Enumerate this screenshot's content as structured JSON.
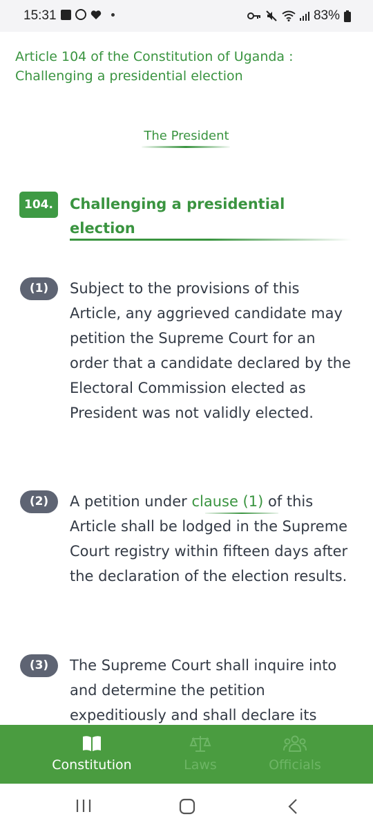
{
  "status_bar": {
    "time": "15:31",
    "battery": "83%",
    "left_icons": [
      "gallery-icon",
      "whatsapp-icon",
      "heart-icon",
      "dot-icon"
    ],
    "right_icons": [
      "key-icon",
      "mute-icon",
      "wifi-icon",
      "signal-icon",
      "battery-icon"
    ]
  },
  "article": {
    "header": "Article 104 of the Constitution of Uganda : Challenging a presidential election",
    "part_title": "The President",
    "section_number": "104.",
    "section_title": "Challenging a presidential election"
  },
  "clauses": [
    {
      "badge": "(1)",
      "text": "Subject to the provisions of this Article, any aggrieved candidate may petition the Supreme Court for an order that a candidate declared by the Electoral Commission elected as President was not validly elected."
    },
    {
      "badge": "(2)",
      "text_before": "A petition under ",
      "link": "clause (1)",
      "text_after": " of this Article shall be lodged in the Supreme Court registry within fifteen days after the declaration of the election results."
    },
    {
      "badge": "(3)",
      "text": "The Supreme Court shall inquire into and determine the petition expeditiously and shall declare its"
    }
  ],
  "bottom_nav": {
    "items": [
      {
        "label": "Constitution",
        "icon": "book-icon",
        "active": true
      },
      {
        "label": "Laws",
        "icon": "scales-icon",
        "active": false
      },
      {
        "label": "Officials",
        "icon": "people-icon",
        "active": false
      }
    ]
  },
  "colors": {
    "accent_green": "#3a9440",
    "nav_green": "#4a9c40",
    "badge_gray": "#5e6473",
    "body_text": "#333a45"
  }
}
